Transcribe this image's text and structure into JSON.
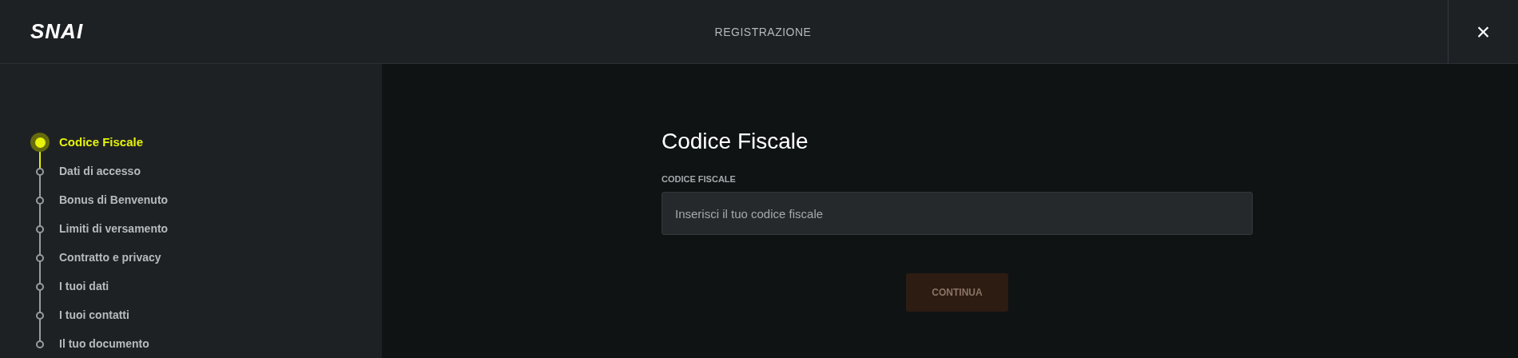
{
  "header": {
    "logo": "SNAI",
    "title": "REGISTRAZIONE",
    "close": "×"
  },
  "steps": [
    {
      "label": "Codice Fiscale",
      "selected": true
    },
    {
      "label": "Dati di accesso",
      "selected": false
    },
    {
      "label": "Bonus di Benvenuto",
      "selected": false
    },
    {
      "label": "Limiti di versamento",
      "selected": false
    },
    {
      "label": "Contratto e privacy",
      "selected": false
    },
    {
      "label": "I tuoi dati",
      "selected": false
    },
    {
      "label": "I tuoi contatti",
      "selected": false
    },
    {
      "label": "Il tuo documento",
      "selected": false
    }
  ],
  "form": {
    "heading": "Codice Fiscale",
    "field_label": "CODICE FISCALE",
    "placeholder": "Inserisci il tuo codice fiscale",
    "button": {
      "label": "CONTINUA",
      "disabled": true
    }
  }
}
